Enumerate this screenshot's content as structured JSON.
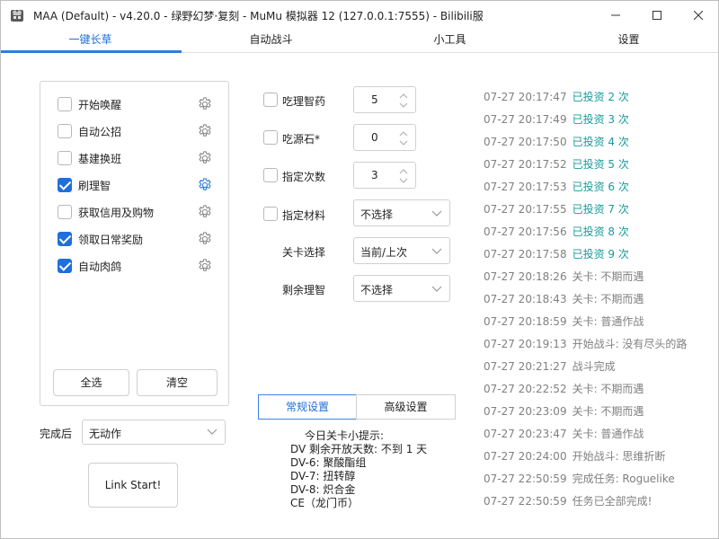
{
  "window": {
    "title": "MAA (Default) - v4.20.0 - 绿野幻梦·复刻 - MuMu 模拟器 12 (127.0.0.1:7555) - Bilibili服",
    "icon": "maa-logo-icon"
  },
  "tabs": [
    {
      "label": "一键长草"
    },
    {
      "label": "自动战斗"
    },
    {
      "label": "小工具"
    },
    {
      "label": "设置"
    }
  ],
  "tasks": [
    {
      "label": "开始唤醒",
      "checked": false
    },
    {
      "label": "自动公招",
      "checked": false
    },
    {
      "label": "基建换班",
      "checked": false
    },
    {
      "label": "刷理智",
      "checked": true
    },
    {
      "label": "获取信用及购物",
      "checked": false
    },
    {
      "label": "领取日常奖励",
      "checked": true
    },
    {
      "label": "自动肉鸽",
      "checked": true
    }
  ],
  "task_buttons": {
    "select_all": "全选",
    "clear": "清空"
  },
  "after_complete": {
    "label": "完成后",
    "value": "无动作"
  },
  "link_start": "Link Start!",
  "options": {
    "sanity_potion": {
      "label": "吃理智药",
      "value": "5"
    },
    "originium": {
      "label": "吃源石*",
      "value": "0"
    },
    "times": {
      "label": "指定次数",
      "value": "3"
    },
    "material": {
      "label": "指定材料",
      "value": "不选择"
    },
    "stage": {
      "label": "关卡选择",
      "value": "当前/上次"
    },
    "remaining": {
      "label": "剩余理智",
      "value": "不选择"
    }
  },
  "settings_tabs": {
    "normal": "常规设置",
    "advanced": "高级设置"
  },
  "tips": [
    "今日关卡小提示:",
    "DV 剩余开放天数: 不到 1 天",
    "DV-6: 聚酸酯组",
    "DV-7: 扭转醇",
    "DV-8: 炽合金",
    "CE（龙门币）"
  ],
  "log": [
    {
      "time": "07-27  20:17:47",
      "msg": "已投资 2 次",
      "color": "teal"
    },
    {
      "time": "07-27  20:17:49",
      "msg": "已投资 3 次",
      "color": "teal"
    },
    {
      "time": "07-27  20:17:50",
      "msg": "已投资 4 次",
      "color": "teal"
    },
    {
      "time": "07-27  20:17:52",
      "msg": "已投资 5 次",
      "color": "teal"
    },
    {
      "time": "07-27  20:17:53",
      "msg": "已投资 6 次",
      "color": "teal"
    },
    {
      "time": "07-27  20:17:55",
      "msg": "已投资 7 次",
      "color": "teal"
    },
    {
      "time": "07-27  20:17:56",
      "msg": "已投资 8 次",
      "color": "teal"
    },
    {
      "time": "07-27  20:17:58",
      "msg": "已投资 9 次",
      "color": "teal"
    },
    {
      "time": "07-27  20:18:26",
      "msg": "关卡: 不期而遇",
      "color": "gray"
    },
    {
      "time": "07-27  20:18:43",
      "msg": "关卡: 不期而遇",
      "color": "gray"
    },
    {
      "time": "07-27  20:18:59",
      "msg": "关卡: 普通作战",
      "color": "gray"
    },
    {
      "time": "07-27  20:19:13",
      "msg": "开始战斗: 没有尽头的路",
      "color": "gray"
    },
    {
      "time": "07-27  20:21:27",
      "msg": "战斗完成",
      "color": "gray"
    },
    {
      "time": "07-27  20:22:52",
      "msg": "关卡: 不期而遇",
      "color": "gray"
    },
    {
      "time": "07-27  20:23:09",
      "msg": "关卡: 不期而遇",
      "color": "gray"
    },
    {
      "time": "07-27  20:23:47",
      "msg": "关卡: 普通作战",
      "color": "gray"
    },
    {
      "time": "07-27  20:24:00",
      "msg": "开始战斗: 思维折断",
      "color": "gray"
    },
    {
      "time": "07-27  22:50:59",
      "msg": "完成任务: Roguelike",
      "color": "gray"
    },
    {
      "time": "07-27  22:50:59",
      "msg": "任务已全部完成!",
      "color": "gray"
    }
  ],
  "colors": {
    "accent": "#1f6fdc",
    "teal": "#1a9a9a",
    "log_gray": "#808080"
  }
}
